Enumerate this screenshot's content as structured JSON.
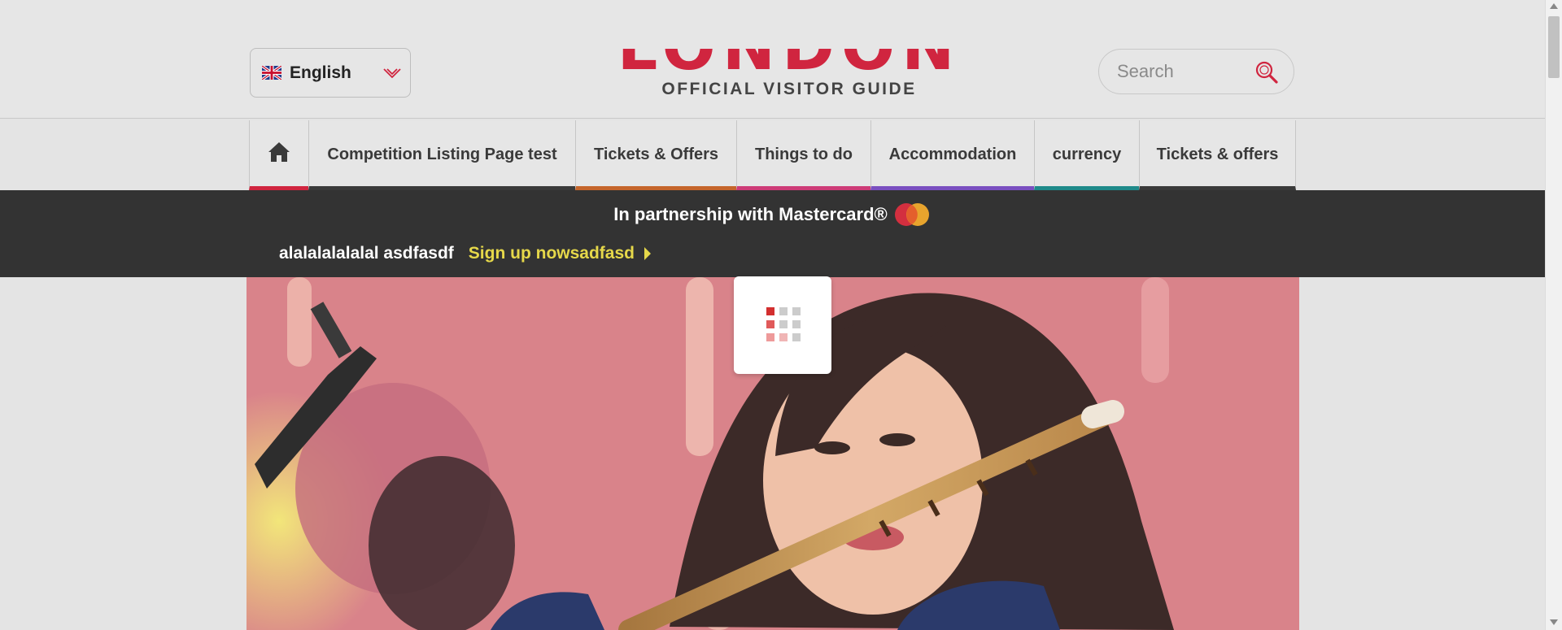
{
  "header": {
    "language": {
      "label": "English",
      "flag_icon": "uk-flag-icon",
      "dropdown_icon": "chevron-down-icon"
    },
    "logo": {
      "title": "VISIT LONDON",
      "subtitle": "OFFICIAL VISITOR GUIDE",
      "brand_color": "#d0253f"
    },
    "search": {
      "placeholder": "Search",
      "value": "",
      "icon": "search-icon",
      "icon_color": "#d0253f"
    }
  },
  "nav": {
    "home_icon": "home-icon",
    "items": [
      {
        "label": "Competition Listing Page test",
        "accent": "#3a3a3a"
      },
      {
        "label": "Tickets & Offers",
        "accent": "#c5652b"
      },
      {
        "label": "Things to do",
        "accent": "#cd3b77"
      },
      {
        "label": "Accommodation",
        "accent": "#7a4fc0"
      },
      {
        "label": "currency",
        "accent": "#1f8a8a"
      },
      {
        "label": "Tickets & offers",
        "accent": "#3a3a3a"
      }
    ],
    "home_accent": "#d0253f"
  },
  "promo": {
    "partnership_text": "In partnership with Mastercard®",
    "logo_icon": "mastercard-logo-icon",
    "message": "alalalalalalal asdfasdf",
    "signup_label": "Sign up nowsadfasd",
    "signup_color": "#e6d84a",
    "background": "#333333"
  },
  "hero": {
    "image": "hero-image"
  },
  "loader": {
    "icon": "loading-spinner-icon"
  }
}
